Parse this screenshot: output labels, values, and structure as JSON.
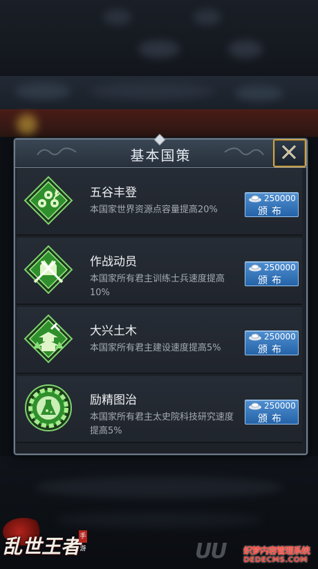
{
  "dialog": {
    "title": "基本国策",
    "close_icon": "close-x-icon"
  },
  "policies": [
    {
      "name": "五谷丰登",
      "description": "本国家世界资源点容量提高20%",
      "cost": "250000",
      "button_label": "颁布",
      "icon": "grain-coins-icon"
    },
    {
      "name": "作战动员",
      "description": "本国家所有君主训练士兵速度提高10%",
      "cost": "250000",
      "button_label": "颁布",
      "icon": "crossed-swords-fortress-icon"
    },
    {
      "name": "大兴土木",
      "description": "本国家所有君主建设速度提高5%",
      "cost": "250000",
      "button_label": "颁布",
      "icon": "pagoda-hammer-icon"
    },
    {
      "name": "励精图治",
      "description": "本国家所有君主太史院科技研究速度提高5%",
      "cost": "250000",
      "button_label": "颁布",
      "icon": "flask-gear-icon"
    }
  ],
  "branding": {
    "game_logo": "乱世王者",
    "seal": "手游"
  },
  "watermark": {
    "logo": "UU",
    "cn": "织梦内容管理系统",
    "en": "DEDECMS.COM"
  },
  "colors": {
    "button_blue": "#2f70b8",
    "icon_green": "#3fae3c",
    "frame_gold": "#c9a24e"
  }
}
